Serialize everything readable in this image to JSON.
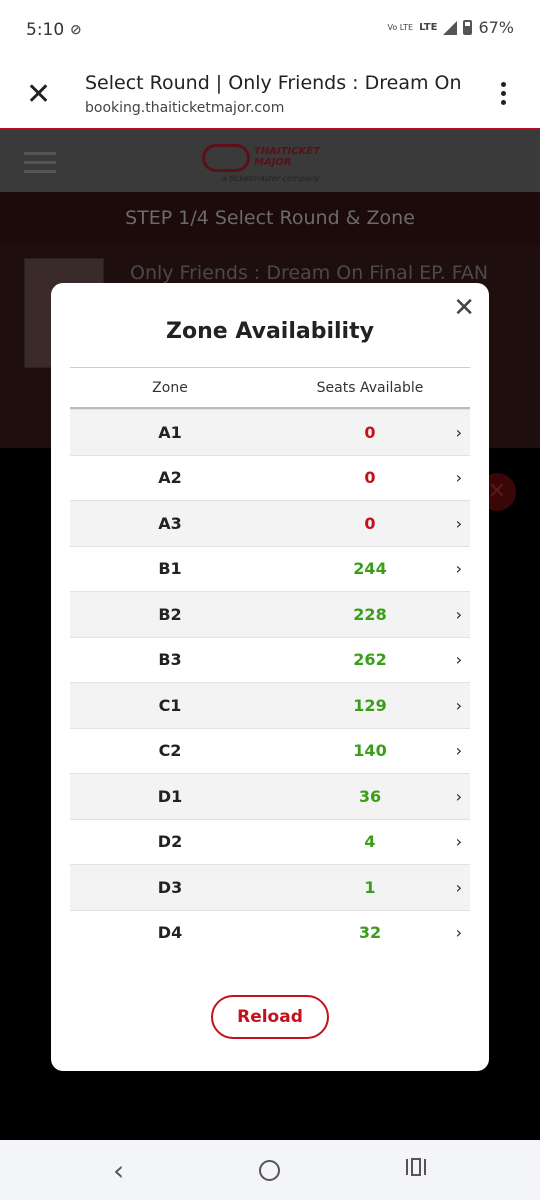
{
  "status": {
    "time": "5:10",
    "app_icon": "link-icon",
    "volte": "Vo LTE",
    "network": "LTE",
    "battery": "67%"
  },
  "browser": {
    "title": "Select Round | Only Friends : Dream On ...",
    "url": "booking.thaiticketmajor.com"
  },
  "site": {
    "logo_name": "THAITICKET MAJOR",
    "logo_sub": "a ticketmaster company",
    "step": "STEP 1/4 Select Round & Zone",
    "event_title": "Only Friends : Dream On Final EP. FAN"
  },
  "modal": {
    "title": "Zone Availability",
    "headers": {
      "zone": "Zone",
      "seats": "Seats Available"
    },
    "rows": [
      {
        "zone": "A1",
        "seats": "0"
      },
      {
        "zone": "A2",
        "seats": "0"
      },
      {
        "zone": "A3",
        "seats": "0"
      },
      {
        "zone": "B1",
        "seats": "244"
      },
      {
        "zone": "B2",
        "seats": "228"
      },
      {
        "zone": "B3",
        "seats": "262"
      },
      {
        "zone": "C1",
        "seats": "129"
      },
      {
        "zone": "C2",
        "seats": "140"
      },
      {
        "zone": "D1",
        "seats": "36"
      },
      {
        "zone": "D2",
        "seats": "4"
      },
      {
        "zone": "D3",
        "seats": "1"
      },
      {
        "zone": "D4",
        "seats": "32"
      }
    ],
    "reload_label": "Reload"
  },
  "colors": {
    "accent": "#c4111b",
    "available": "#3a9e1a",
    "unavailable": "#c4111b"
  }
}
